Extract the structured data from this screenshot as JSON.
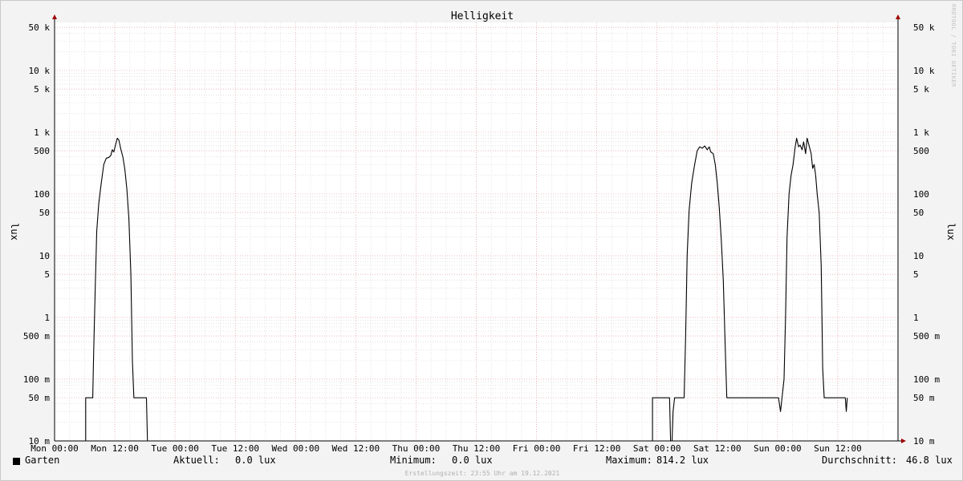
{
  "chart_data": {
    "type": "line",
    "title": "Helligkeit",
    "ylabel": "lux",
    "y_scale": "log",
    "ylim": [
      0.01,
      60000
    ],
    "y_ticks": [
      {
        "v": 0.01,
        "label": "10 m"
      },
      {
        "v": 0.05,
        "label": "50 m"
      },
      {
        "v": 0.1,
        "label": "100 m"
      },
      {
        "v": 0.5,
        "label": "500 m"
      },
      {
        "v": 1,
        "label": "1"
      },
      {
        "v": 5,
        "label": "5"
      },
      {
        "v": 10,
        "label": "10"
      },
      {
        "v": 50,
        "label": "50"
      },
      {
        "v": 100,
        "label": "100"
      },
      {
        "v": 500,
        "label": "500"
      },
      {
        "v": 1000,
        "label": "1 k"
      },
      {
        "v": 5000,
        "label": "5 k"
      },
      {
        "v": 10000,
        "label": "10 k"
      },
      {
        "v": 50000,
        "label": "50 k"
      }
    ],
    "x_unit": "hours since Mon 00:00",
    "xlim": [
      0,
      168
    ],
    "x_ticks": [
      {
        "v": 0,
        "label": "Mon 00:00"
      },
      {
        "v": 12,
        "label": "Mon 12:00"
      },
      {
        "v": 24,
        "label": "Tue 00:00"
      },
      {
        "v": 36,
        "label": "Tue 12:00"
      },
      {
        "v": 48,
        "label": "Wed 00:00"
      },
      {
        "v": 60,
        "label": "Wed 12:00"
      },
      {
        "v": 72,
        "label": "Thu 00:00"
      },
      {
        "v": 84,
        "label": "Thu 12:00"
      },
      {
        "v": 96,
        "label": "Fri 00:00"
      },
      {
        "v": 108,
        "label": "Fri 12:00"
      },
      {
        "v": 120,
        "label": "Sat 00:00"
      },
      {
        "v": 132,
        "label": "Sat 12:00"
      },
      {
        "v": 144,
        "label": "Sun 00:00"
      },
      {
        "v": 156,
        "label": "Sun 12:00"
      }
    ],
    "grid": true,
    "series": [
      {
        "name": "Garten",
        "color": "#000000",
        "points": [
          [
            0,
            0.01
          ],
          [
            6.2,
            0.01
          ],
          [
            6.2,
            0.05
          ],
          [
            7.6,
            0.05
          ],
          [
            7.8,
            0.3
          ],
          [
            8.1,
            3
          ],
          [
            8.4,
            25
          ],
          [
            8.8,
            70
          ],
          [
            9.3,
            150
          ],
          [
            9.8,
            300
          ],
          [
            10.3,
            380
          ],
          [
            10.8,
            390
          ],
          [
            11.2,
            420
          ],
          [
            11.5,
            520
          ],
          [
            11.8,
            480
          ],
          [
            12.2,
            650
          ],
          [
            12.5,
            800
          ],
          [
            12.8,
            750
          ],
          [
            13.2,
            530
          ],
          [
            13.6,
            400
          ],
          [
            14.0,
            250
          ],
          [
            14.4,
            120
          ],
          [
            14.8,
            40
          ],
          [
            15.2,
            5
          ],
          [
            15.5,
            0.2
          ],
          [
            15.8,
            0.05
          ],
          [
            18.3,
            0.05
          ],
          [
            18.5,
            0.01
          ],
          [
            119.1,
            0.01
          ],
          [
            119.1,
            0.05
          ],
          [
            119.3,
            0.05
          ],
          [
            119.5,
            0.05
          ],
          [
            119.7,
            0.05
          ],
          [
            120.0,
            0.05
          ],
          [
            122.5,
            0.05
          ],
          [
            122.7,
            0.01
          ],
          [
            123.0,
            0.01
          ],
          [
            123.2,
            0.03
          ],
          [
            123.5,
            0.05
          ],
          [
            125.4,
            0.05
          ],
          [
            125.7,
            0.5
          ],
          [
            126.0,
            10
          ],
          [
            126.4,
            55
          ],
          [
            126.9,
            150
          ],
          [
            127.5,
            300
          ],
          [
            128.0,
            500
          ],
          [
            128.5,
            580
          ],
          [
            129.0,
            550
          ],
          [
            129.5,
            600
          ],
          [
            130.0,
            520
          ],
          [
            130.4,
            580
          ],
          [
            130.7,
            480
          ],
          [
            131.2,
            450
          ],
          [
            131.6,
            300
          ],
          [
            132.0,
            150
          ],
          [
            132.4,
            60
          ],
          [
            132.8,
            18
          ],
          [
            133.2,
            4
          ],
          [
            133.6,
            0.3
          ],
          [
            133.9,
            0.05
          ],
          [
            144.2,
            0.05
          ],
          [
            144.6,
            0.03
          ],
          [
            144.9,
            0.05
          ],
          [
            145.3,
            0.1
          ],
          [
            145.6,
            1
          ],
          [
            145.9,
            20
          ],
          [
            146.3,
            100
          ],
          [
            146.7,
            200
          ],
          [
            147.1,
            300
          ],
          [
            147.5,
            560
          ],
          [
            147.8,
            800
          ],
          [
            148.2,
            580
          ],
          [
            148.5,
            620
          ],
          [
            148.9,
            520
          ],
          [
            149.2,
            700
          ],
          [
            149.6,
            450
          ],
          [
            149.9,
            800
          ],
          [
            150.3,
            600
          ],
          [
            150.7,
            450
          ],
          [
            151.0,
            260
          ],
          [
            151.3,
            300
          ],
          [
            151.6,
            200
          ],
          [
            151.9,
            100
          ],
          [
            152.3,
            50
          ],
          [
            152.7,
            7
          ],
          [
            153.0,
            0.15
          ],
          [
            153.3,
            0.05
          ],
          [
            157.5,
            0.05
          ],
          [
            157.7,
            0.03
          ],
          [
            157.9,
            0.05
          ]
        ]
      }
    ]
  },
  "legend": {
    "series_name": "Garten",
    "aktuell_label": "Aktuell:",
    "aktuell_value": "0.0 lux",
    "minimum_label": "Minimum:",
    "minimum_value": "0.0 lux",
    "maximum_label": "Maximum:",
    "maximum_value": "814.2 lux",
    "avg_label": "Durchschnitt:",
    "avg_value": "46.8 lux"
  },
  "footer": "Erstellungszeit: 23:55 Uhr am 19.12.2021",
  "watermark": "RRDTOOL / TOBI OETIKER"
}
